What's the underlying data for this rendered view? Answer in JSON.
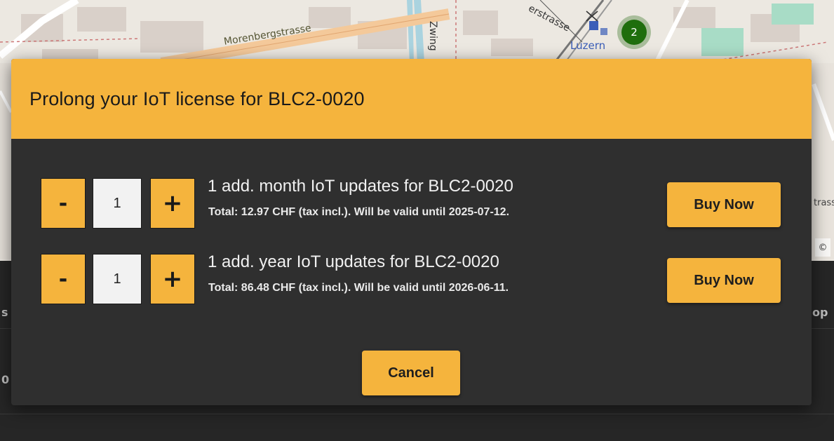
{
  "map": {
    "street_label": "Morenbergstrasse",
    "zwing_label": "Zwing",
    "strasse_label": "erstrasse",
    "city_label": "Luzern",
    "cluster_count": "2",
    "edge_label": "trass",
    "copyright_symbol": "©"
  },
  "background_page": {
    "left_fragment_1": "s",
    "left_fragment_2": "0",
    "right_fragment": "op"
  },
  "modal": {
    "title": "Prolong your IoT license for BLC2-0020",
    "header_color": "#f5b43d",
    "offers": [
      {
        "minus_label": "-",
        "quantity": "1",
        "plus_label": "+",
        "title": "1 add. month IoT updates for BLC2-0020",
        "subtitle": "Total: 12.97 CHF (tax incl.). Will be valid until 2025-07-12.",
        "buy_label": "Buy Now"
      },
      {
        "minus_label": "-",
        "quantity": "1",
        "plus_label": "+",
        "title": "1 add. year IoT updates for BLC2-0020",
        "subtitle": "Total: 86.48 CHF (tax incl.). Will be valid until 2026-06-11.",
        "buy_label": "Buy Now"
      }
    ],
    "cancel_label": "Cancel"
  }
}
